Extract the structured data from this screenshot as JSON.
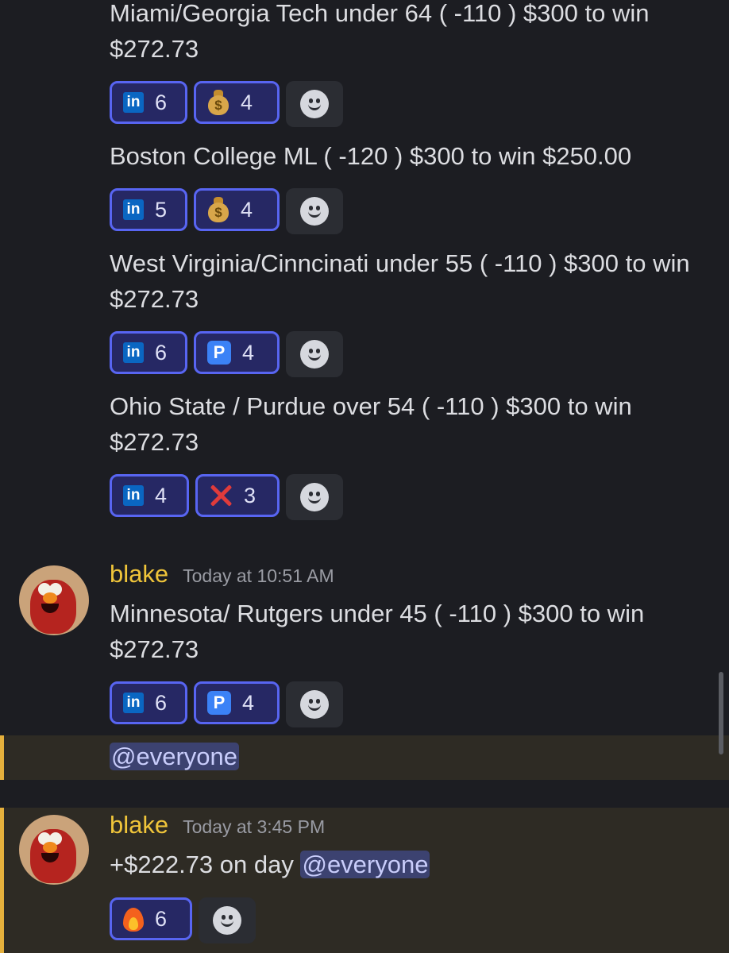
{
  "colors": {
    "background": "#1c1d22",
    "reaction_bg": "#262864",
    "reaction_border": "#5865f2",
    "mention_bg": "#3c4270",
    "highlight_bg": "#2e2b24",
    "highlight_bar": "#e5b03c",
    "author": "#f0c53a"
  },
  "messages": [
    {
      "text": "Miami/Georgia Tech under 64 ( -110 ) $300 to win $272.73",
      "reactions": [
        {
          "icon": "linkedin-icon",
          "count": "6"
        },
        {
          "icon": "money-bag-icon",
          "count": "4"
        }
      ]
    },
    {
      "text": "Boston College ML ( -120 ) $300 to win $250.00",
      "reactions": [
        {
          "icon": "linkedin-icon",
          "count": "5"
        },
        {
          "icon": "money-bag-icon",
          "count": "4"
        }
      ]
    },
    {
      "text": "West Virginia/Cinncinati under 55 ( -110 ) $300 to win $272.73",
      "reactions": [
        {
          "icon": "linkedin-icon",
          "count": "6"
        },
        {
          "icon": "p-button-icon",
          "count": "4"
        }
      ]
    },
    {
      "text": "Ohio State / Purdue over 54 ( -110 ) $300 to win $272.73",
      "reactions": [
        {
          "icon": "linkedin-icon",
          "count": "4"
        },
        {
          "icon": "cross-mark-icon",
          "count": "3"
        }
      ]
    }
  ],
  "group2": {
    "author": "blake",
    "timestamp": "Today at 10:51 AM",
    "text": "Minnesota/ Rutgers under 45 ( -110 ) $300 to win $272.73",
    "reactions": [
      {
        "icon": "linkedin-icon",
        "count": "6"
      },
      {
        "icon": "p-button-icon",
        "count": "4"
      }
    ],
    "mention": "@everyone"
  },
  "group3": {
    "author": "blake",
    "timestamp": "Today at 3:45 PM",
    "text_prefix": "+$222.73 on day ",
    "mention": "@everyone",
    "reactions": [
      {
        "icon": "fire-icon",
        "count": "6"
      }
    ]
  },
  "emoji_glyphs": {
    "linkedin": "in",
    "p_button": "P",
    "money_sign": "$"
  }
}
